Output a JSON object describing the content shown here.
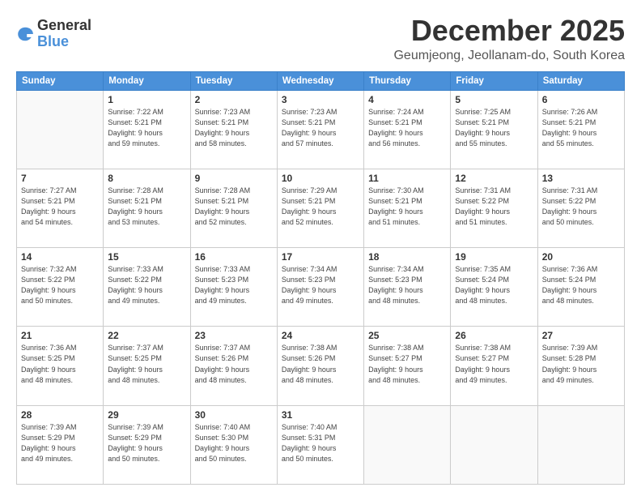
{
  "header": {
    "logo_general": "General",
    "logo_blue": "Blue",
    "month": "December 2025",
    "location": "Geumjeong, Jeollanam-do, South Korea"
  },
  "days_of_week": [
    "Sunday",
    "Monday",
    "Tuesday",
    "Wednesday",
    "Thursday",
    "Friday",
    "Saturday"
  ],
  "weeks": [
    [
      {
        "day": "",
        "info": ""
      },
      {
        "day": "1",
        "info": "Sunrise: 7:22 AM\nSunset: 5:21 PM\nDaylight: 9 hours\nand 59 minutes."
      },
      {
        "day": "2",
        "info": "Sunrise: 7:23 AM\nSunset: 5:21 PM\nDaylight: 9 hours\nand 58 minutes."
      },
      {
        "day": "3",
        "info": "Sunrise: 7:23 AM\nSunset: 5:21 PM\nDaylight: 9 hours\nand 57 minutes."
      },
      {
        "day": "4",
        "info": "Sunrise: 7:24 AM\nSunset: 5:21 PM\nDaylight: 9 hours\nand 56 minutes."
      },
      {
        "day": "5",
        "info": "Sunrise: 7:25 AM\nSunset: 5:21 PM\nDaylight: 9 hours\nand 55 minutes."
      },
      {
        "day": "6",
        "info": "Sunrise: 7:26 AM\nSunset: 5:21 PM\nDaylight: 9 hours\nand 55 minutes."
      }
    ],
    [
      {
        "day": "7",
        "info": "Sunrise: 7:27 AM\nSunset: 5:21 PM\nDaylight: 9 hours\nand 54 minutes."
      },
      {
        "day": "8",
        "info": "Sunrise: 7:28 AM\nSunset: 5:21 PM\nDaylight: 9 hours\nand 53 minutes."
      },
      {
        "day": "9",
        "info": "Sunrise: 7:28 AM\nSunset: 5:21 PM\nDaylight: 9 hours\nand 52 minutes."
      },
      {
        "day": "10",
        "info": "Sunrise: 7:29 AM\nSunset: 5:21 PM\nDaylight: 9 hours\nand 52 minutes."
      },
      {
        "day": "11",
        "info": "Sunrise: 7:30 AM\nSunset: 5:21 PM\nDaylight: 9 hours\nand 51 minutes."
      },
      {
        "day": "12",
        "info": "Sunrise: 7:31 AM\nSunset: 5:22 PM\nDaylight: 9 hours\nand 51 minutes."
      },
      {
        "day": "13",
        "info": "Sunrise: 7:31 AM\nSunset: 5:22 PM\nDaylight: 9 hours\nand 50 minutes."
      }
    ],
    [
      {
        "day": "14",
        "info": "Sunrise: 7:32 AM\nSunset: 5:22 PM\nDaylight: 9 hours\nand 50 minutes."
      },
      {
        "day": "15",
        "info": "Sunrise: 7:33 AM\nSunset: 5:22 PM\nDaylight: 9 hours\nand 49 minutes."
      },
      {
        "day": "16",
        "info": "Sunrise: 7:33 AM\nSunset: 5:23 PM\nDaylight: 9 hours\nand 49 minutes."
      },
      {
        "day": "17",
        "info": "Sunrise: 7:34 AM\nSunset: 5:23 PM\nDaylight: 9 hours\nand 49 minutes."
      },
      {
        "day": "18",
        "info": "Sunrise: 7:34 AM\nSunset: 5:23 PM\nDaylight: 9 hours\nand 48 minutes."
      },
      {
        "day": "19",
        "info": "Sunrise: 7:35 AM\nSunset: 5:24 PM\nDaylight: 9 hours\nand 48 minutes."
      },
      {
        "day": "20",
        "info": "Sunrise: 7:36 AM\nSunset: 5:24 PM\nDaylight: 9 hours\nand 48 minutes."
      }
    ],
    [
      {
        "day": "21",
        "info": "Sunrise: 7:36 AM\nSunset: 5:25 PM\nDaylight: 9 hours\nand 48 minutes."
      },
      {
        "day": "22",
        "info": "Sunrise: 7:37 AM\nSunset: 5:25 PM\nDaylight: 9 hours\nand 48 minutes."
      },
      {
        "day": "23",
        "info": "Sunrise: 7:37 AM\nSunset: 5:26 PM\nDaylight: 9 hours\nand 48 minutes."
      },
      {
        "day": "24",
        "info": "Sunrise: 7:38 AM\nSunset: 5:26 PM\nDaylight: 9 hours\nand 48 minutes."
      },
      {
        "day": "25",
        "info": "Sunrise: 7:38 AM\nSunset: 5:27 PM\nDaylight: 9 hours\nand 48 minutes."
      },
      {
        "day": "26",
        "info": "Sunrise: 7:38 AM\nSunset: 5:27 PM\nDaylight: 9 hours\nand 49 minutes."
      },
      {
        "day": "27",
        "info": "Sunrise: 7:39 AM\nSunset: 5:28 PM\nDaylight: 9 hours\nand 49 minutes."
      }
    ],
    [
      {
        "day": "28",
        "info": "Sunrise: 7:39 AM\nSunset: 5:29 PM\nDaylight: 9 hours\nand 49 minutes."
      },
      {
        "day": "29",
        "info": "Sunrise: 7:39 AM\nSunset: 5:29 PM\nDaylight: 9 hours\nand 50 minutes."
      },
      {
        "day": "30",
        "info": "Sunrise: 7:40 AM\nSunset: 5:30 PM\nDaylight: 9 hours\nand 50 minutes."
      },
      {
        "day": "31",
        "info": "Sunrise: 7:40 AM\nSunset: 5:31 PM\nDaylight: 9 hours\nand 50 minutes."
      },
      {
        "day": "",
        "info": ""
      },
      {
        "day": "",
        "info": ""
      },
      {
        "day": "",
        "info": ""
      }
    ]
  ]
}
